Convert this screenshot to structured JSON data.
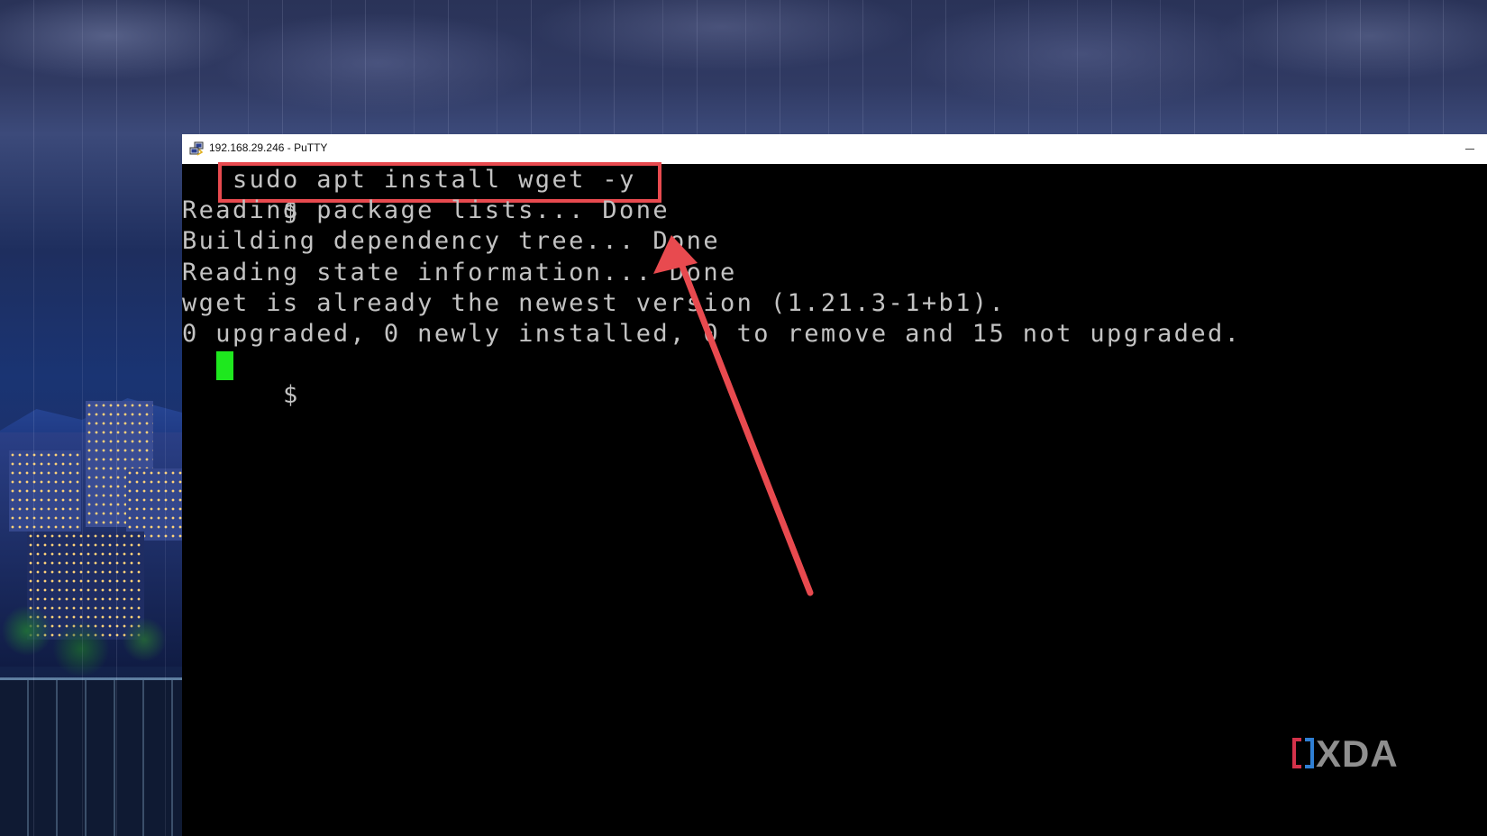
{
  "window": {
    "title": "192.168.29.246 - PuTTY",
    "app_icon": "putty-icon",
    "minimize_icon": "minimize-icon"
  },
  "terminal": {
    "prompt": "$",
    "command": "sudo apt install wget -y",
    "output": [
      "Reading package lists... Done",
      "Building dependency tree... Done",
      "Reading state information... Done",
      "wget is already the newest version (1.21.3-1+b1).",
      "0 upgraded, 0 newly installed, 0 to remove and 15 not upgraded."
    ],
    "final_prompt": "$",
    "cursor_color": "#1ee81e",
    "text_color": "#c3c3c3",
    "background_color": "#000000"
  },
  "annotation": {
    "highlight_color": "#e84a4f",
    "arrow_color": "#e84a4f"
  },
  "watermark": {
    "text": "XDA",
    "bracket_left_color": "#d4324a",
    "bracket_right_color": "#2f7fd4"
  }
}
